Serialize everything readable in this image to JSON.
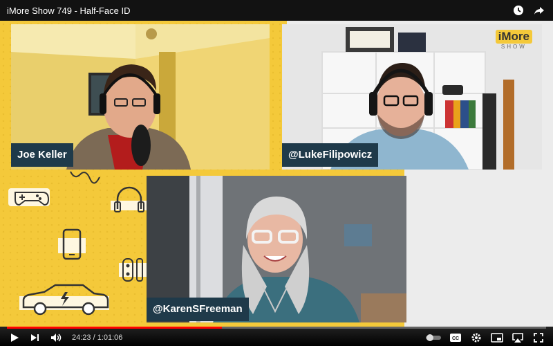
{
  "video": {
    "title": "iMore Show 749 - Half-Face ID"
  },
  "participants": [
    {
      "name": "Joe Keller"
    },
    {
      "name": "@LukeFilipowicz"
    },
    {
      "name": "@KarenSFreeman"
    }
  ],
  "overlay": {
    "brand": "iMore",
    "brand_sub": "SHOW"
  },
  "player": {
    "current_time": "24:23",
    "duration": "1:01:06",
    "time_display": "24:23 / 1:01:06",
    "progress_fraction": 0.399,
    "accent_color": "#ff0000"
  },
  "icons": {
    "title_bar": [
      "watch-later-icon",
      "share-icon"
    ],
    "left_controls": [
      "play-icon",
      "next-icon",
      "volume-icon"
    ],
    "right_controls": [
      "autoplay-toggle-icon",
      "captions-icon",
      "settings-icon",
      "miniplayer-icon",
      "airplay-icon",
      "fullscreen-icon"
    ]
  },
  "colors": {
    "background_yellow": "#f4c93a",
    "nametag_bg": "#1f3a4a"
  }
}
